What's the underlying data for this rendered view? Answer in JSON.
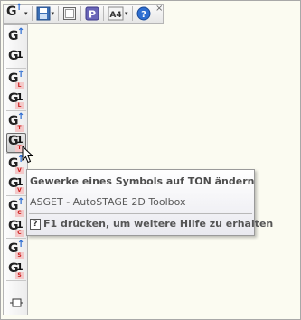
{
  "toolbar": {
    "buttons": [
      {
        "icon": "g-arrow-icon"
      },
      {
        "icon": "save-icon"
      },
      {
        "icon": "frame-icon"
      },
      {
        "icon": "p-icon"
      },
      {
        "icon": "a4-icon",
        "label": "A4"
      },
      {
        "icon": "help-icon"
      }
    ],
    "close_glyph": "×"
  },
  "palette": {
    "items": [
      {
        "main": "G",
        "sup": "↑",
        "sub": ""
      },
      {
        "main": "G",
        "sup": "1",
        "sub": ""
      },
      {
        "main": "G",
        "sup": "↑",
        "sub": "L"
      },
      {
        "main": "G",
        "sup": "1",
        "sub": "L"
      },
      {
        "main": "G",
        "sup": "↑",
        "sub": "T"
      },
      {
        "main": "G",
        "sup": "1",
        "sub": "T"
      },
      {
        "main": "G",
        "sup": "↑",
        "sub": "V"
      },
      {
        "main": "G",
        "sup": "1",
        "sub": "V"
      },
      {
        "main": "G",
        "sup": "↑",
        "sub": "C"
      },
      {
        "main": "G",
        "sup": "1",
        "sub": "C"
      },
      {
        "main": "G",
        "sup": "↑",
        "sub": "S"
      },
      {
        "main": "G",
        "sup": "1",
        "sub": "S"
      }
    ],
    "active_index": 5
  },
  "tooltip": {
    "title": "Gewerke eines Symbols auf TON ändern",
    "description": "ASGET - AutoSTAGE 2D Toolbox",
    "help_glyph": "?",
    "help_text": "F1 drücken, um weitere Hilfe zu erhalten"
  }
}
